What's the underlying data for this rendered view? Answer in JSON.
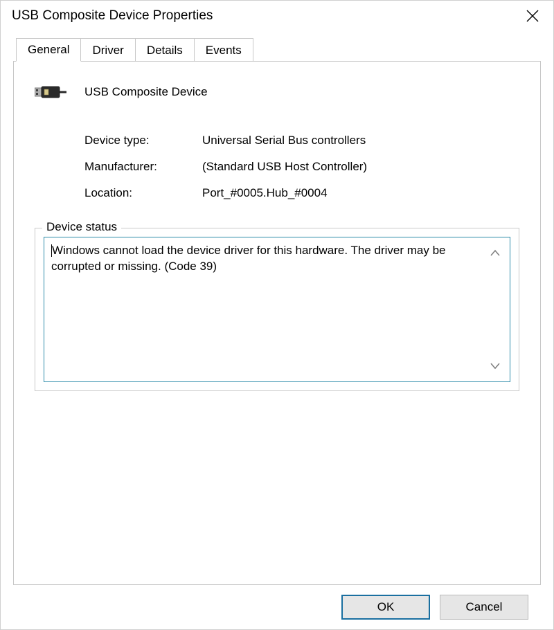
{
  "window": {
    "title": "USB Composite Device Properties"
  },
  "tabs": [
    {
      "label": "General"
    },
    {
      "label": "Driver"
    },
    {
      "label": "Details"
    },
    {
      "label": "Events"
    }
  ],
  "device": {
    "name": "USB Composite Device"
  },
  "info": {
    "device_type_label": "Device type:",
    "device_type_value": "Universal Serial Bus controllers",
    "manufacturer_label": "Manufacturer:",
    "manufacturer_value": "(Standard USB Host Controller)",
    "location_label": "Location:",
    "location_value": "Port_#0005.Hub_#0004"
  },
  "status": {
    "legend": "Device status",
    "text": "Windows cannot load the device driver for this hardware. The driver may be corrupted or missing. (Code 39)"
  },
  "buttons": {
    "ok": "OK",
    "cancel": "Cancel"
  }
}
